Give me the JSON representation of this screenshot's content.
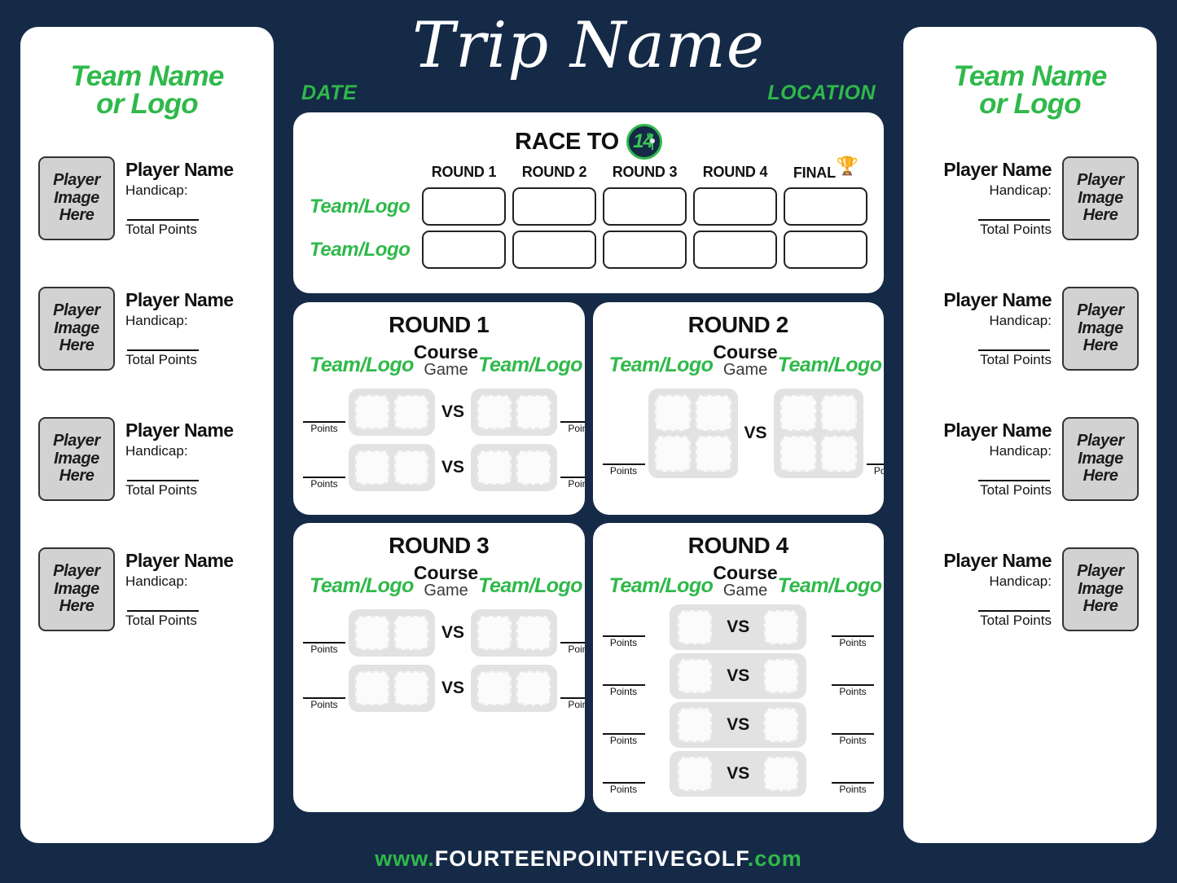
{
  "header": {
    "trip_title": "Trip Name",
    "date_label": "DATE",
    "location_label": "LOCATION"
  },
  "brand": {
    "navy": "#152a47",
    "green": "#2fb94a",
    "logo_number": "14",
    "logo_superscript": "5",
    "footer_www": "www.",
    "footer_domain": "FOURTEENPOINTFIVEGOLF",
    "footer_tld": ".com"
  },
  "teams": {
    "left": {
      "title": "Team Name\nor Logo",
      "title_line1": "Team Name",
      "title_line2": "or Logo",
      "players": [
        {
          "image_placeholder": "Player\nImage\nHere",
          "name": "Player Name",
          "handicap": "Handicap:",
          "total_points": "Total Points"
        },
        {
          "image_placeholder": "Player\nImage\nHere",
          "name": "Player Name",
          "handicap": "Handicap:",
          "total_points": "Total Points"
        },
        {
          "image_placeholder": "Player\nImage\nHere",
          "name": "Player Name",
          "handicap": "Handicap:",
          "total_points": "Total Points"
        },
        {
          "image_placeholder": "Player\nImage\nHere",
          "name": "Player Name",
          "handicap": "Handicap:",
          "total_points": "Total Points"
        }
      ]
    },
    "right": {
      "title_line1": "Team Name",
      "title_line2": "or Logo",
      "players": [
        {
          "image_placeholder": "Player\nImage\nHere",
          "name": "Player Name",
          "handicap": "Handicap:",
          "total_points": "Total Points"
        },
        {
          "image_placeholder": "Player\nImage\nHere",
          "name": "Player Name",
          "handicap": "Handicap:",
          "total_points": "Total Points"
        },
        {
          "image_placeholder": "Player\nImage\nHere",
          "name": "Player Name",
          "handicap": "Handicap:",
          "total_points": "Total Points"
        },
        {
          "image_placeholder": "Player\nImage\nHere",
          "name": "Player Name",
          "handicap": "Handicap:",
          "total_points": "Total Points"
        }
      ]
    }
  },
  "race_to": {
    "title": "RACE TO",
    "trophy_icon": "🏆",
    "columns": [
      "ROUND 1",
      "ROUND 2",
      "ROUND 3",
      "ROUND 4",
      "FINAL"
    ],
    "rows": [
      {
        "label": "Team/Logo",
        "values": [
          "",
          "",
          "",
          "",
          ""
        ]
      },
      {
        "label": "Team/Logo",
        "values": [
          "",
          "",
          "",
          "",
          ""
        ]
      }
    ]
  },
  "rounds": [
    {
      "title": "ROUND 1",
      "course_label": "Course",
      "game_label": "Game",
      "team_left": "Team/Logo",
      "team_right": "Team/Logo",
      "format": "2v2",
      "vs_label": "VS",
      "points_label": "Points",
      "matches": [
        {
          "left_slots": 2,
          "right_slots": 2,
          "left_points": "",
          "right_points": ""
        },
        {
          "left_slots": 2,
          "right_slots": 2,
          "left_points": "",
          "right_points": ""
        }
      ]
    },
    {
      "title": "ROUND 2",
      "course_label": "Course",
      "game_label": "Game",
      "team_left": "Team/Logo",
      "team_right": "Team/Logo",
      "format": "4v4",
      "vs_label": "VS",
      "points_label": "Points",
      "matches": [
        {
          "left_slots": 4,
          "right_slots": 4,
          "left_points": "",
          "right_points": ""
        }
      ]
    },
    {
      "title": "ROUND 3",
      "course_label": "Course",
      "game_label": "Game",
      "team_left": "Team/Logo",
      "team_right": "Team/Logo",
      "format": "2v2",
      "vs_label": "VS",
      "points_label": "Points",
      "matches": [
        {
          "left_slots": 2,
          "right_slots": 2,
          "left_points": "",
          "right_points": ""
        },
        {
          "left_slots": 2,
          "right_slots": 2,
          "left_points": "",
          "right_points": ""
        }
      ]
    },
    {
      "title": "ROUND 4",
      "course_label": "Course",
      "game_label": "Game",
      "team_left": "Team/Logo",
      "team_right": "Team/Logo",
      "format": "1v1",
      "vs_label": "VS",
      "points_label": "Points",
      "matches": [
        {
          "left_slots": 1,
          "right_slots": 1,
          "left_points": "",
          "right_points": ""
        },
        {
          "left_slots": 1,
          "right_slots": 1,
          "left_points": "",
          "right_points": ""
        },
        {
          "left_slots": 1,
          "right_slots": 1,
          "left_points": "",
          "right_points": ""
        },
        {
          "left_slots": 1,
          "right_slots": 1,
          "left_points": "",
          "right_points": ""
        }
      ]
    }
  ]
}
